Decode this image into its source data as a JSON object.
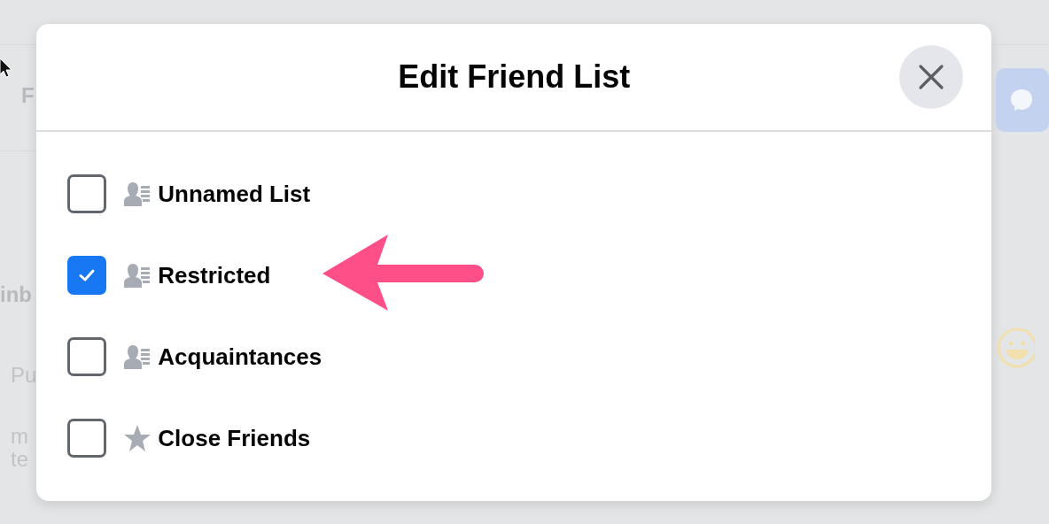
{
  "background": {
    "left_fragments": [
      "F",
      "inb",
      "Pu",
      "m",
      "te"
    ]
  },
  "dialog": {
    "title": "Edit Friend List",
    "lists": [
      {
        "label": "Unnamed List",
        "kind": "list",
        "checked": false
      },
      {
        "label": "Restricted",
        "kind": "list",
        "checked": true
      },
      {
        "label": "Acquaintances",
        "kind": "list",
        "checked": false
      },
      {
        "label": "Close Friends",
        "kind": "star",
        "checked": false
      }
    ]
  }
}
